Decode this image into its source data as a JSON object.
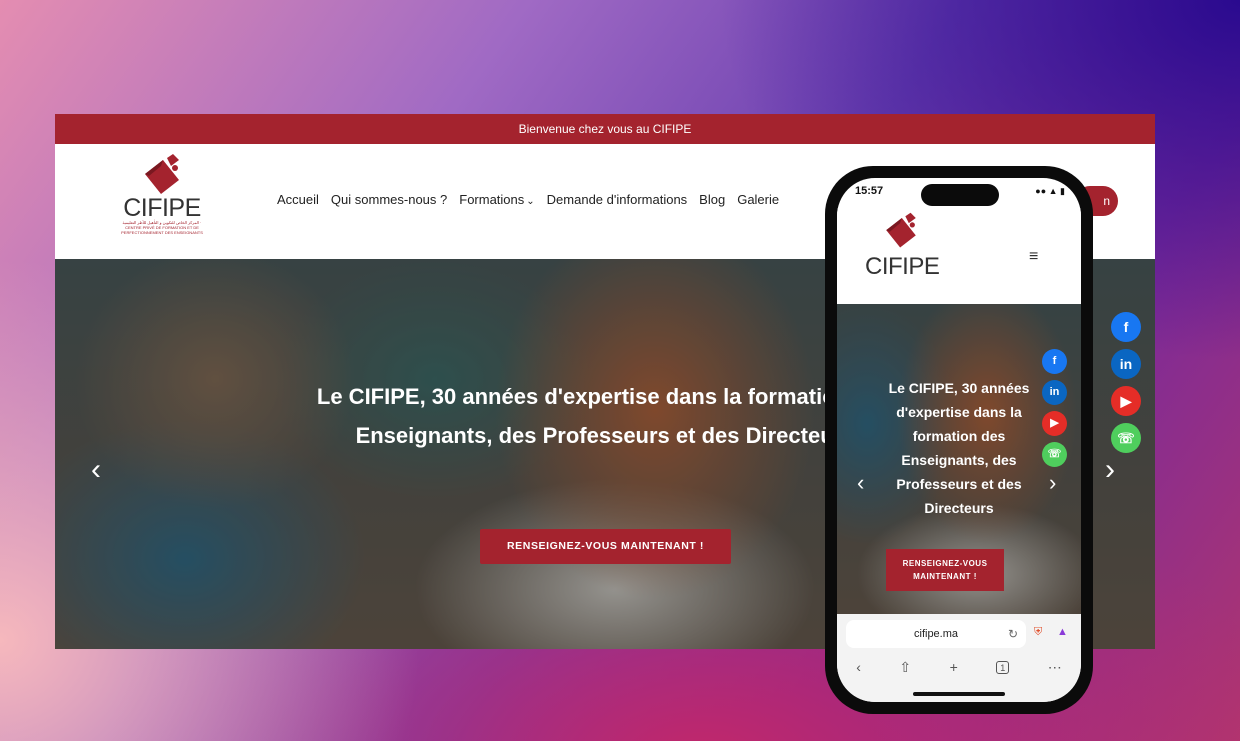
{
  "desktop": {
    "topbar_text": "Bienvenue chez vous au CIFIPE",
    "logo_text": "CIFIPE",
    "logo_sub": "المركز الخاص للتكوين و التأهيل للأطر التعليمية · CENTRE PRIVÉ DE FORMATION ET DE PERFECTIONNEMENT DES ENSEIGNANTS",
    "nav": [
      "Accueil",
      "Qui sommes-nous ?",
      "Formations",
      "Demande d'informations",
      "Blog",
      "Galerie"
    ],
    "nav_dropdown_icon": "chevron-down-icon",
    "nav_button_label": "n",
    "hero_title": "Le CIFIPE, 30 années d'expertise dans la formation des Enseignants, des Professeurs et des Directeurs",
    "hero_button": "RENSEIGNEZ-VOUS MAINTENANT !",
    "prev_icon": "chevron-left-icon",
    "next_icon": "chevron-right-icon",
    "social": [
      "facebook-icon",
      "linkedin-icon",
      "youtube-icon",
      "whatsapp-icon"
    ],
    "accent_color": "#a4232e"
  },
  "mobile": {
    "time": "15:57",
    "logo_text": "CIFIPE",
    "menu_icon": "hamburger-icon",
    "hero_title": "Le CIFIPE, 30 années d'expertise dans la formation des Enseignants, des Professeurs et des Directeurs",
    "hero_button": "RENSEIGNEZ-VOUS MAINTENANT !",
    "url": "cifipe.ma",
    "tab_count": "1",
    "browser_tools": [
      "back-icon",
      "share-icon",
      "new-tab-icon",
      "tabs-icon",
      "more-icon"
    ]
  }
}
